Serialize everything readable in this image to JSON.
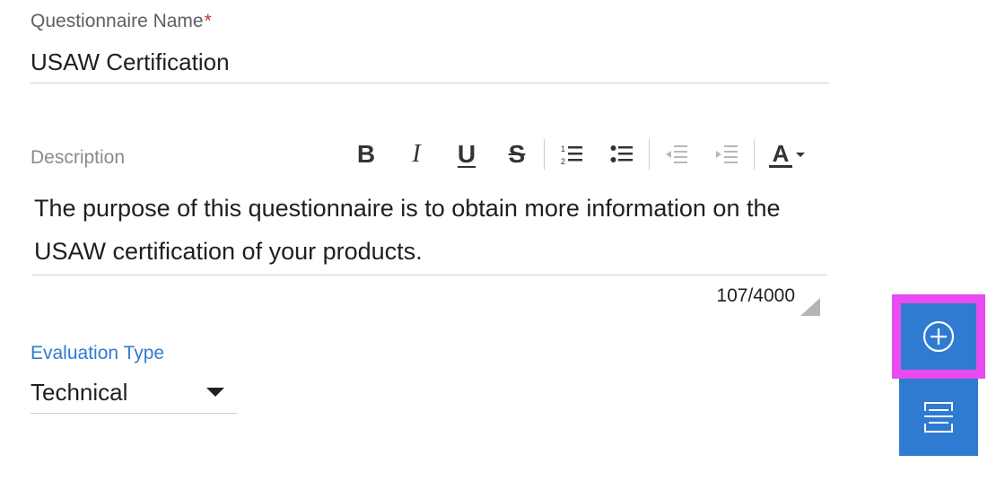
{
  "questionnaire_name": {
    "label": "Questionnaire Name",
    "required_marker": "*",
    "value": "USAW Certification"
  },
  "description": {
    "label": "Description",
    "text": "The purpose of this questionnaire is to obtain more information on the USAW certification of your products.",
    "counter": "107/4000",
    "toolbar": {
      "bold": "B",
      "italic": "I",
      "underline": "U",
      "strikethrough": "S",
      "font_color": "A"
    }
  },
  "evaluation_type": {
    "label": "Evaluation Type",
    "value": "Technical"
  },
  "colors": {
    "accent": "#2f7bd1",
    "highlight": "#e84bf0",
    "required": "#c0392b"
  },
  "icons": {
    "add": "plus-circle-icon",
    "section": "section-break-icon"
  }
}
